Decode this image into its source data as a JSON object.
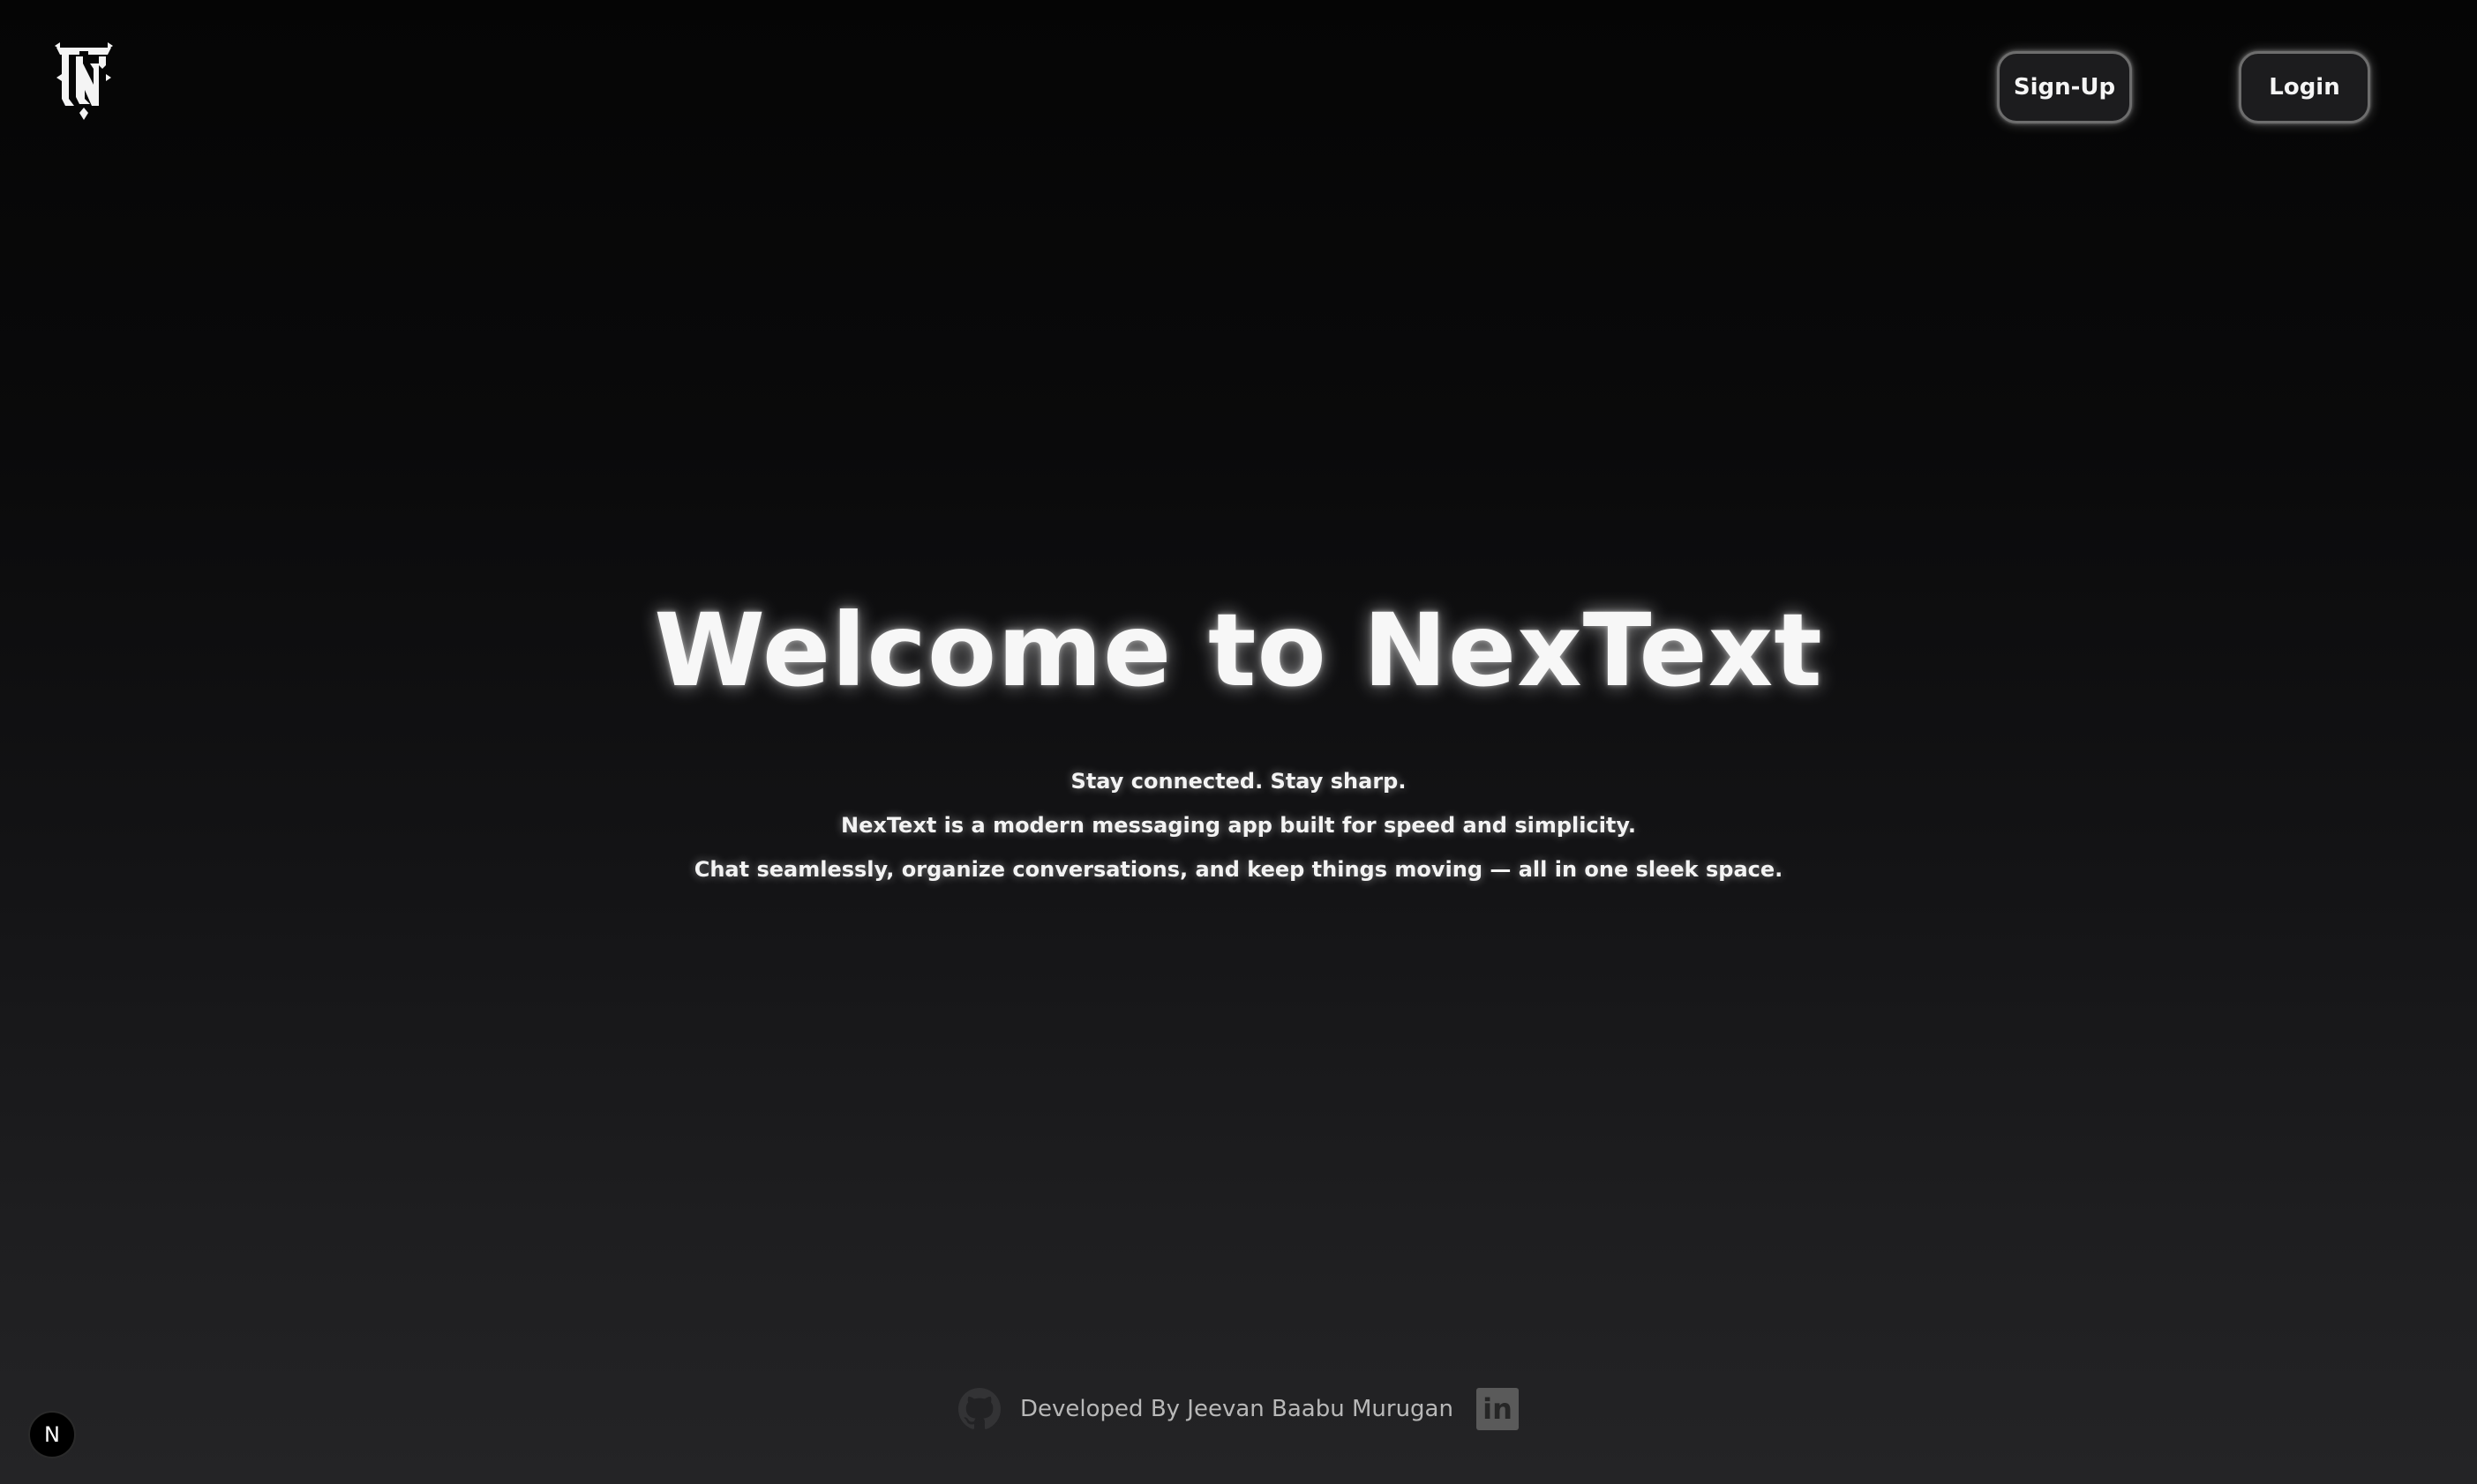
{
  "header": {
    "logo_icon": "nextext-gothic-logo-icon",
    "signup_label": "Sign-Up",
    "login_label": "Login"
  },
  "hero": {
    "title": "Welcome to NexText",
    "lines": [
      "Stay connected. Stay sharp.",
      "NexText is a modern messaging app built for speed and simplicity.",
      "Chat seamlessly, organize conversations, and keep things moving — all in one sleek space."
    ]
  },
  "footer": {
    "github_icon": "github-icon",
    "developer_text": "Developed By Jeevan Baabu Murugan",
    "linkedin_icon": "linkedin-icon",
    "linkedin_glyph": "in"
  },
  "dev_badge": {
    "icon": "nextjs-icon",
    "glyph": "N"
  },
  "colors": {
    "background_top": "#050505",
    "background_bottom": "#242426",
    "text": "#f2f2f2",
    "muted_text": "#b8b8b8",
    "button_border": "#6d6d6d"
  }
}
